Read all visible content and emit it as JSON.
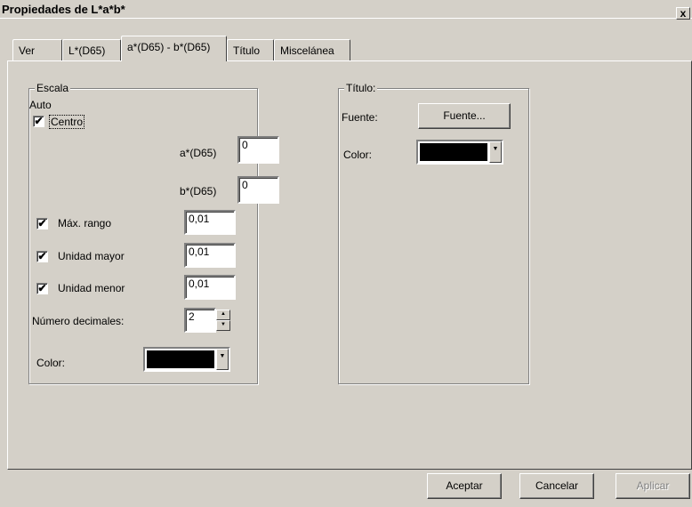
{
  "window": {
    "title": "Propiedades de L*a*b*",
    "close": "x"
  },
  "tabs": [
    {
      "label": "Ver"
    },
    {
      "label": "L*(D65)"
    },
    {
      "label": "a*(D65) - b*(D65)"
    },
    {
      "label": "Título"
    },
    {
      "label": "Miscelánea"
    }
  ],
  "escala": {
    "legend": "Escala",
    "auto_label": "Auto",
    "centro_label": "Centro",
    "centro_checked": "✔",
    "a_label": "a*(D65)",
    "a_value": "0",
    "b_label": "b*(D65)",
    "b_value": "0",
    "max_rango_label": "Máx. rango",
    "max_rango_value": "0,01",
    "unidad_mayor_label": "Unidad mayor",
    "unidad_mayor_value": "0,01",
    "unidad_menor_label": "Unidad menor",
    "unidad_menor_value": "0,01",
    "decimales_label": "Número decimales:",
    "decimales_value": "2",
    "color_label": "Color:",
    "color_value": "#000000"
  },
  "titulo": {
    "legend": "Título:",
    "fuente_label": "Fuente:",
    "fuente_button": "Fuente...",
    "color_label": "Color:",
    "color_value": "#000000"
  },
  "footer": {
    "aceptar": "Aceptar",
    "cancelar": "Cancelar",
    "aplicar": "Aplicar"
  },
  "icons": {
    "check": "✔",
    "spin_up": "▲",
    "spin_down": "▼",
    "dropdown": "▼"
  }
}
